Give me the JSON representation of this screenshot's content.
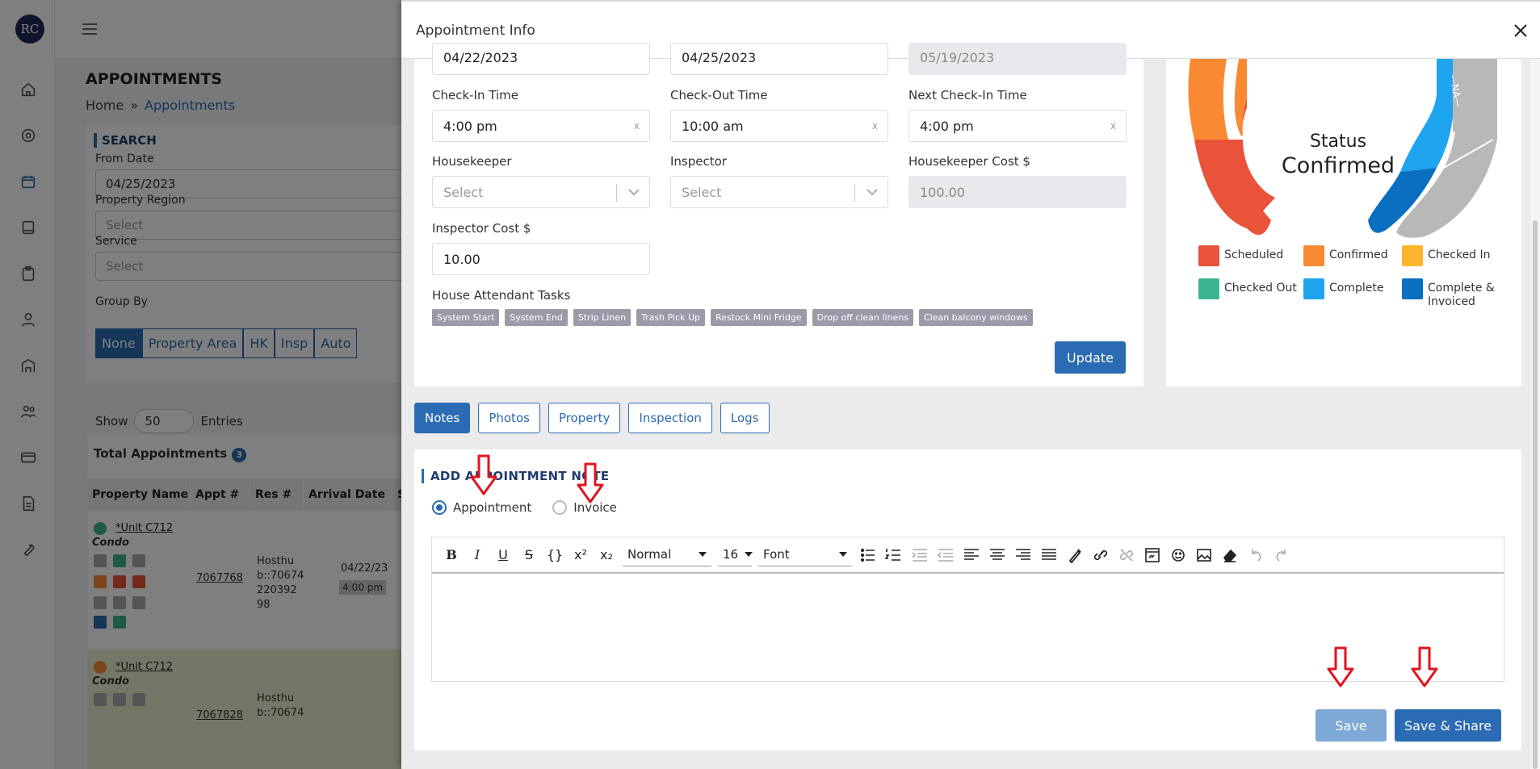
{
  "app": {
    "logo_text": "RC",
    "page_title": "APPOINTMENTS",
    "breadcrumb": {
      "home": "Home",
      "sep": "»",
      "current": "Appointments"
    },
    "search": {
      "title": "SEARCH",
      "from_date_label": "From Date",
      "from_date_value": "04/25/2023",
      "property_region_label": "Property Region",
      "property_region_placeholder": "Select",
      "service_label": "Service",
      "service_placeholder": "Select",
      "group_by_label": "Group By",
      "group_by_options": [
        "None",
        "Property Area",
        "HK",
        "Insp",
        "Auto"
      ]
    },
    "show": {
      "label_show": "Show",
      "value": "50",
      "label_entries": "Entries"
    },
    "table": {
      "title": "Total Appointments",
      "count": "3",
      "headers": [
        "Property Name",
        "Appt #",
        "Res #",
        "Arrival Date",
        "S"
      ],
      "rows": [
        {
          "unit": "*Unit C712",
          "kind": "Condo",
          "appt": "7067768",
          "res_1": "Hosthu",
          "res_2": "b::70674",
          "res_3": "220392",
          "res_4": "98",
          "arrival": "04/22/23",
          "time": "4:00 pm",
          "extra": "0"
        },
        {
          "unit": "*Unit C712",
          "kind": "Condo",
          "appt": "7067828",
          "res_1": "Hosthu",
          "res_2": "b::70674",
          "extra": "0"
        }
      ]
    }
  },
  "modal": {
    "title": "Appointment Info",
    "dates_row": [
      "04/22/2023",
      "04/25/2023",
      "05/19/2023"
    ],
    "check_in_label": "Check-In Time",
    "check_in_value": "4:00 pm",
    "check_out_label": "Check-Out Time",
    "check_out_value": "10:00 am",
    "next_check_in_label": "Next Check-In Time",
    "next_check_in_value": "4:00 pm",
    "clear_glyph": "x",
    "housekeeper_label": "Housekeeper",
    "housekeeper_placeholder": "Select",
    "inspector_label": "Inspector",
    "inspector_placeholder": "Select",
    "housekeeper_cost_label": "Housekeeper Cost $",
    "housekeeper_cost_value": "100.00",
    "inspector_cost_label": "Inspector Cost $",
    "inspector_cost_value": "10.00",
    "tasks_label": "House Attendant Tasks",
    "tasks": [
      "System Start",
      "System End",
      "Strip Linen",
      "Trash Pick Up",
      "Restock Mini Fridge",
      "Drop off clean linens",
      "Clean balcony windows"
    ],
    "update_button": "Update",
    "status": {
      "label": "Status",
      "value": "Confirmed",
      "na_text": "—NA—",
      "legend": [
        {
          "label": "Scheduled",
          "color": "#e8533a"
        },
        {
          "label": "Confirmed",
          "color": "#f98a33"
        },
        {
          "label": "Checked In",
          "color": "#fbb52d"
        },
        {
          "label": "Checked Out",
          "color": "#3bb591"
        },
        {
          "label": "Complete",
          "color": "#1fa4ef"
        },
        {
          "label": "Complete & Invoiced",
          "color": "#0a6ec1"
        }
      ]
    },
    "tabs": [
      "Notes",
      "Photos",
      "Property",
      "Inspection",
      "Logs"
    ],
    "active_tab": "Notes",
    "notes": {
      "title": "ADD APPOINTMENT NOTE",
      "radio_appointment": "Appointment",
      "radio_invoice": "Invoice",
      "toolbar": {
        "bold": "B",
        "italic": "I",
        "underline": "U",
        "strike": "S",
        "code": "{}",
        "superscript": "x²",
        "subscript": "x₂",
        "heading_value": "Normal",
        "size_value": "16",
        "font_value": "Font"
      },
      "save_button": "Save",
      "save_share_button": "Save & Share"
    }
  },
  "colors": {
    "primary": "#2a6bb3",
    "annotation_arrow": "#e0141e"
  }
}
